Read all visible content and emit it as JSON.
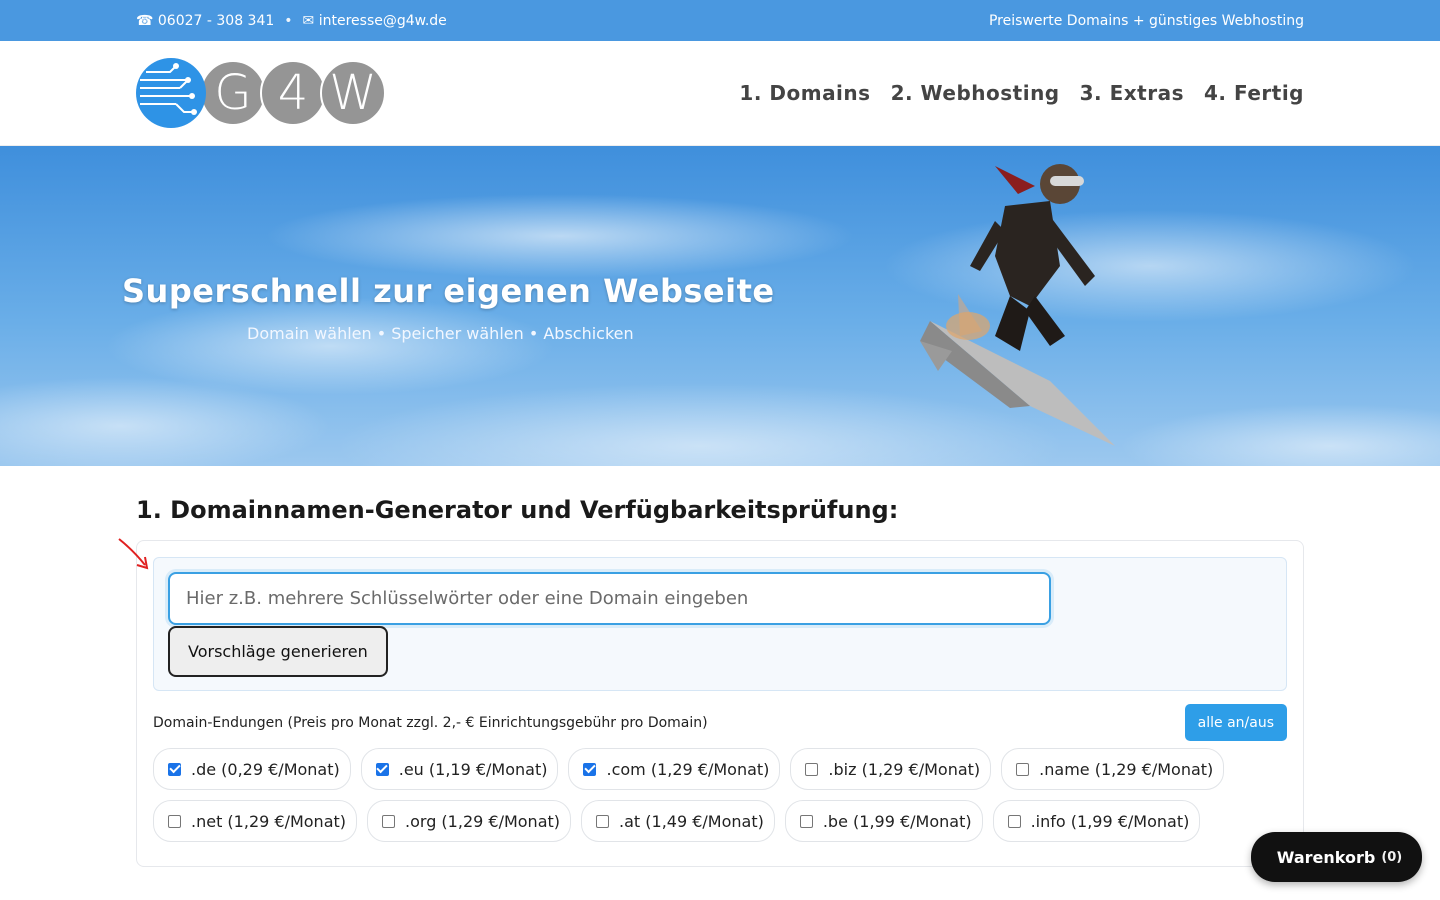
{
  "topbar": {
    "phone": "☎ 06027 - 308 341",
    "separator": "•",
    "email": "✉ interesse@g4w.de",
    "tagline": "Preiswerte Domains + günstiges Webhosting"
  },
  "logo": {
    "letters": [
      "G",
      "4",
      "W"
    ]
  },
  "nav": [
    {
      "label": "1. Domains"
    },
    {
      "label": "2. Webhosting"
    },
    {
      "label": "3. Extras"
    },
    {
      "label": "4. Fertig"
    }
  ],
  "hero": {
    "title": "Superschnell zur eigenen Webseite",
    "subtitle": "Domain wählen • Speicher wählen • Abschicken"
  },
  "section": {
    "title": "1. Domainnamen-Generator und Verfügbarkeitsprüfung:",
    "search_placeholder": "Hier z.B. mehrere Schlüsselwörter oder eine Domain eingeben",
    "generate_label": "Vorschläge generieren",
    "tld_label": "Domain-Endungen (Preis pro Monat zzgl. 2,- € Einrichtungsgebühr pro Domain)",
    "toggle_label": "alle an/aus",
    "tlds_row1": [
      {
        "label": ".de (0,29 €/Monat)",
        "checked": true
      },
      {
        "label": ".eu (1,19 €/Monat)",
        "checked": true
      },
      {
        "label": ".com (1,29 €/Monat)",
        "checked": true
      },
      {
        "label": ".biz (1,29 €/Monat)",
        "checked": false
      },
      {
        "label": ".name (1,29 €/Monat)",
        "checked": false
      }
    ],
    "tlds_row2": [
      {
        "label": ".net (1,29 €/Monat)",
        "checked": false
      },
      {
        "label": ".org (1,29 €/Monat)",
        "checked": false
      },
      {
        "label": ".at (1,49 €/Monat)",
        "checked": false
      },
      {
        "label": ".be (1,99 €/Monat)",
        "checked": false
      },
      {
        "label": ".info (1,99 €/Monat)",
        "checked": false
      }
    ]
  },
  "cart": {
    "icon": "",
    "label": "Warenkorb",
    "count": "(0)"
  },
  "colors": {
    "accent": "#4a98e0",
    "button": "#2e9ee8",
    "focus": "#3aa0e3"
  }
}
